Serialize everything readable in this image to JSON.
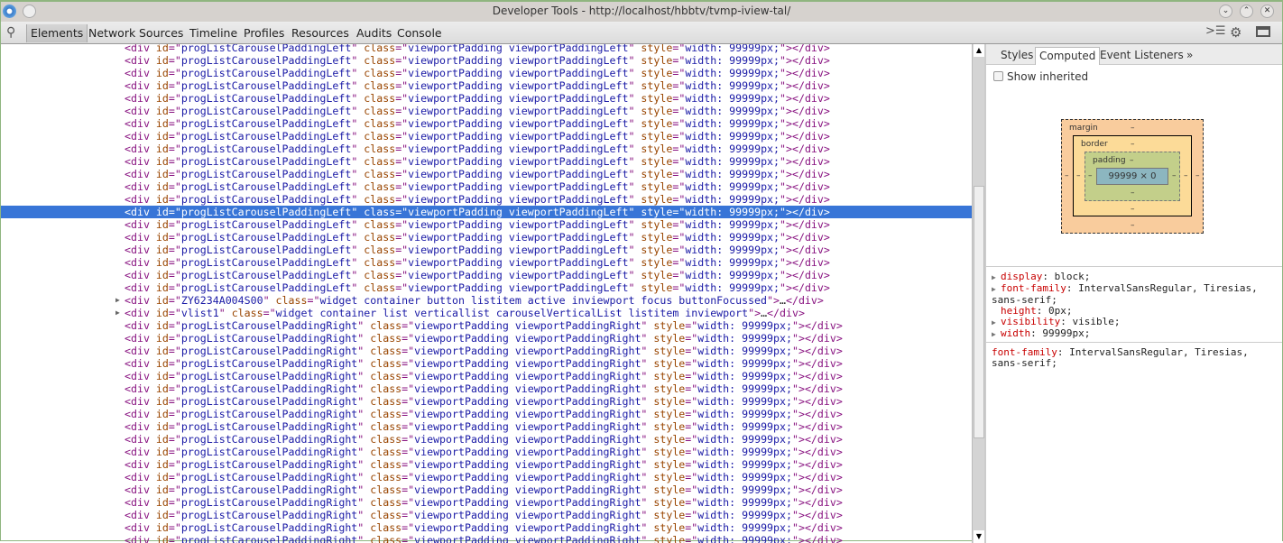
{
  "window": {
    "title": "Developer Tools - http://localhost/hbbtv/tvmp-iview-tal/"
  },
  "toolbar": {
    "tabs": [
      "Elements",
      "Network",
      "Sources",
      "Timeline",
      "Profiles",
      "Resources",
      "Audits",
      "Console"
    ],
    "active": "Elements"
  },
  "elements": {
    "rows": [
      {
        "id": "progListCarouselPaddingLeft",
        "class": "viewportPadding viewportPaddingLeft",
        "style": "width: 99999px;"
      },
      {
        "id": "progListCarouselPaddingLeft",
        "class": "viewportPadding viewportPaddingLeft",
        "style": "width: 99999px;"
      },
      {
        "id": "progListCarouselPaddingLeft",
        "class": "viewportPadding viewportPaddingLeft",
        "style": "width: 99999px;"
      },
      {
        "id": "progListCarouselPaddingLeft",
        "class": "viewportPadding viewportPaddingLeft",
        "style": "width: 99999px;"
      },
      {
        "id": "progListCarouselPaddingLeft",
        "class": "viewportPadding viewportPaddingLeft",
        "style": "width: 99999px;"
      },
      {
        "id": "progListCarouselPaddingLeft",
        "class": "viewportPadding viewportPaddingLeft",
        "style": "width: 99999px;"
      },
      {
        "id": "progListCarouselPaddingLeft",
        "class": "viewportPadding viewportPaddingLeft",
        "style": "width: 99999px;"
      },
      {
        "id": "progListCarouselPaddingLeft",
        "class": "viewportPadding viewportPaddingLeft",
        "style": "width: 99999px;"
      },
      {
        "id": "progListCarouselPaddingLeft",
        "class": "viewportPadding viewportPaddingLeft",
        "style": "width: 99999px;"
      },
      {
        "id": "progListCarouselPaddingLeft",
        "class": "viewportPadding viewportPaddingLeft",
        "style": "width: 99999px;"
      },
      {
        "id": "progListCarouselPaddingLeft",
        "class": "viewportPadding viewportPaddingLeft",
        "style": "width: 99999px;"
      },
      {
        "id": "progListCarouselPaddingLeft",
        "class": "viewportPadding viewportPaddingLeft",
        "style": "width: 99999px;"
      },
      {
        "id": "progListCarouselPaddingLeft",
        "class": "viewportPadding viewportPaddingLeft",
        "style": "width: 99999px;"
      },
      {
        "id": "progListCarouselPaddingLeft",
        "class": "viewportPadding viewportPaddingLeft",
        "style": "width: 99999px;",
        "selected": true
      },
      {
        "id": "progListCarouselPaddingLeft",
        "class": "viewportPadding viewportPaddingLeft",
        "style": "width: 99999px;"
      },
      {
        "id": "progListCarouselPaddingLeft",
        "class": "viewportPadding viewportPaddingLeft",
        "style": "width: 99999px;"
      },
      {
        "id": "progListCarouselPaddingLeft",
        "class": "viewportPadding viewportPaddingLeft",
        "style": "width: 99999px;"
      },
      {
        "id": "progListCarouselPaddingLeft",
        "class": "viewportPadding viewportPaddingLeft",
        "style": "width: 99999px;"
      },
      {
        "id": "progListCarouselPaddingLeft",
        "class": "viewportPadding viewportPaddingLeft",
        "style": "width: 99999px;"
      },
      {
        "id": "progListCarouselPaddingLeft",
        "class": "viewportPadding viewportPaddingLeft",
        "style": "width: 99999px;"
      },
      {
        "id": "ZY6234A004S00",
        "class": "widget container button listitem active inviewport focus buttonFocussed",
        "collapsed": true
      },
      {
        "id": "vlist1",
        "class": "widget container list verticallist carouselVerticalList listitem inviewport",
        "collapsed": true
      },
      {
        "id": "progListCarouselPaddingRight",
        "class": "viewportPadding viewportPaddingRight",
        "style": "width: 99999px;"
      },
      {
        "id": "progListCarouselPaddingRight",
        "class": "viewportPadding viewportPaddingRight",
        "style": "width: 99999px;"
      },
      {
        "id": "progListCarouselPaddingRight",
        "class": "viewportPadding viewportPaddingRight",
        "style": "width: 99999px;"
      },
      {
        "id": "progListCarouselPaddingRight",
        "class": "viewportPadding viewportPaddingRight",
        "style": "width: 99999px;"
      },
      {
        "id": "progListCarouselPaddingRight",
        "class": "viewportPadding viewportPaddingRight",
        "style": "width: 99999px;"
      },
      {
        "id": "progListCarouselPaddingRight",
        "class": "viewportPadding viewportPaddingRight",
        "style": "width: 99999px;"
      },
      {
        "id": "progListCarouselPaddingRight",
        "class": "viewportPadding viewportPaddingRight",
        "style": "width: 99999px;"
      },
      {
        "id": "progListCarouselPaddingRight",
        "class": "viewportPadding viewportPaddingRight",
        "style": "width: 99999px;"
      },
      {
        "id": "progListCarouselPaddingRight",
        "class": "viewportPadding viewportPaddingRight",
        "style": "width: 99999px;"
      },
      {
        "id": "progListCarouselPaddingRight",
        "class": "viewportPadding viewportPaddingRight",
        "style": "width: 99999px;"
      },
      {
        "id": "progListCarouselPaddingRight",
        "class": "viewportPadding viewportPaddingRight",
        "style": "width: 99999px;"
      },
      {
        "id": "progListCarouselPaddingRight",
        "class": "viewportPadding viewportPaddingRight",
        "style": "width: 99999px;"
      },
      {
        "id": "progListCarouselPaddingRight",
        "class": "viewportPadding viewportPaddingRight",
        "style": "width: 99999px;"
      },
      {
        "id": "progListCarouselPaddingRight",
        "class": "viewportPadding viewportPaddingRight",
        "style": "width: 99999px;"
      },
      {
        "id": "progListCarouselPaddingRight",
        "class": "viewportPadding viewportPaddingRight",
        "style": "width: 99999px;"
      },
      {
        "id": "progListCarouselPaddingRight",
        "class": "viewportPadding viewportPaddingRight",
        "style": "width: 99999px;"
      },
      {
        "id": "progListCarouselPaddingRight",
        "class": "viewportPadding viewportPaddingRight",
        "style": "width: 99999px;"
      },
      {
        "id": "progListCarouselPaddingRight",
        "class": "viewportPadding viewportPaddingRight",
        "style": "width: 99999px;"
      },
      {
        "id": "progListCarouselPaddingRight",
        "class": "viewportPadding viewportPaddingRight",
        "style": "width: 99999px;"
      }
    ]
  },
  "sidebar": {
    "tabs": [
      "Styles",
      "Computed",
      "Event Listeners",
      "»"
    ],
    "active": "Computed",
    "show_inherited": "Show inherited",
    "box_model": {
      "margin": "margin",
      "border": "border",
      "padding": "padding",
      "dash": "–",
      "content": "99999 × 0"
    },
    "computed": [
      {
        "name": "display",
        "value": "block;",
        "expandable": true
      },
      {
        "name": "font-family",
        "value": "IntervalSansRegular, Tiresias, sans-serif;",
        "expandable": true
      },
      {
        "name": "height",
        "value": "0px;",
        "expandable": false
      },
      {
        "name": "visibility",
        "value": "visible;",
        "expandable": true
      },
      {
        "name": "width",
        "value": "99999px;",
        "expandable": true
      }
    ],
    "rule": {
      "name": "font-family",
      "value": "IntervalSansRegular, Tiresias, sans-serif;"
    }
  },
  "colors": {
    "selection": "#3875d7",
    "tag": "#881280",
    "attr_name": "#994500",
    "attr_value": "#1a1aa6",
    "margin": "#f9cc9d",
    "border": "#fcdb98",
    "padding": "#c3cf8a",
    "content": "#8cb6c0"
  }
}
